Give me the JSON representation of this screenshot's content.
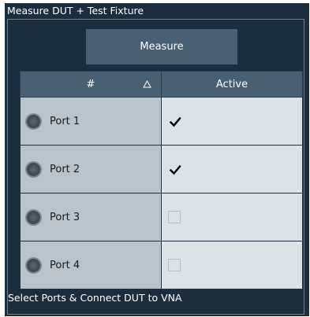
{
  "panel": {
    "title": "Measure DUT + Test Fixture"
  },
  "measure_button": {
    "label": "Measure"
  },
  "table": {
    "headers": {
      "number": "#",
      "active": "Active"
    },
    "rows": [
      {
        "port": "Port 1",
        "active": true
      },
      {
        "port": "Port 2",
        "active": true
      },
      {
        "port": "Port 3",
        "active": false
      },
      {
        "port": "Port 4",
        "active": false
      }
    ]
  },
  "status": {
    "text": "Select Ports & Connect DUT to VNA"
  },
  "colors": {
    "panel_bg": "#1c2d3e",
    "header_bg": "#4a6072",
    "port_cell_bg": "#b8c3cc",
    "active_cell_bg": "#dce3e8"
  }
}
